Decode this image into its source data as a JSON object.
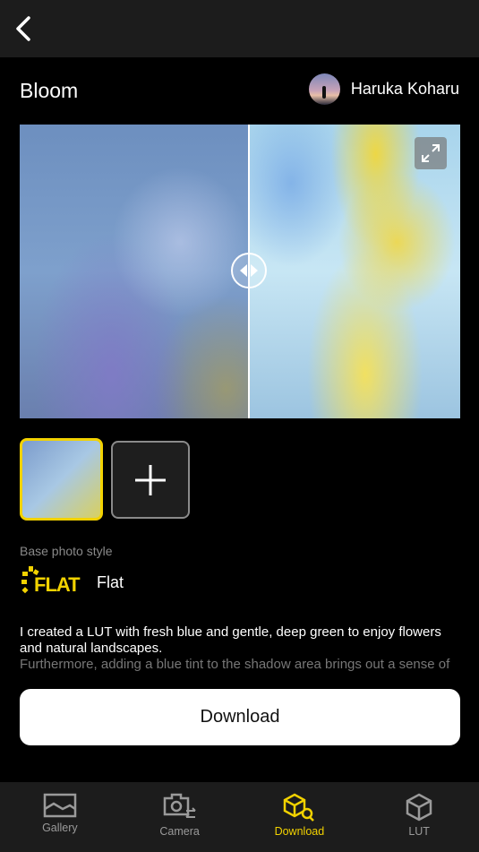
{
  "header": {
    "back_icon": "chevron-left-icon"
  },
  "lut": {
    "title": "Bloom",
    "author": "Haruka Koharu"
  },
  "preview": {
    "compare_position_percent": 52,
    "expand_icon": "expand-icon"
  },
  "base_style": {
    "label": "Base photo style",
    "logo_text": "FLAT",
    "name": "Flat"
  },
  "description": {
    "line1": "I created a LUT with fresh blue and gentle, deep green to enjoy flowers and natural landscapes.",
    "line2": "Furthermore, adding a blue tint to the shadow area brings out a sense of"
  },
  "download_label": "Download",
  "nav": {
    "items": [
      {
        "label": "Gallery",
        "icon": "gallery-icon"
      },
      {
        "label": "Camera",
        "icon": "camera-switch-icon"
      },
      {
        "label": "Download",
        "icon": "cube-search-icon",
        "active": true
      },
      {
        "label": "LUT",
        "icon": "cube-icon"
      }
    ]
  },
  "colors": {
    "accent": "#f2d200",
    "bar": "#1c1c1c"
  }
}
